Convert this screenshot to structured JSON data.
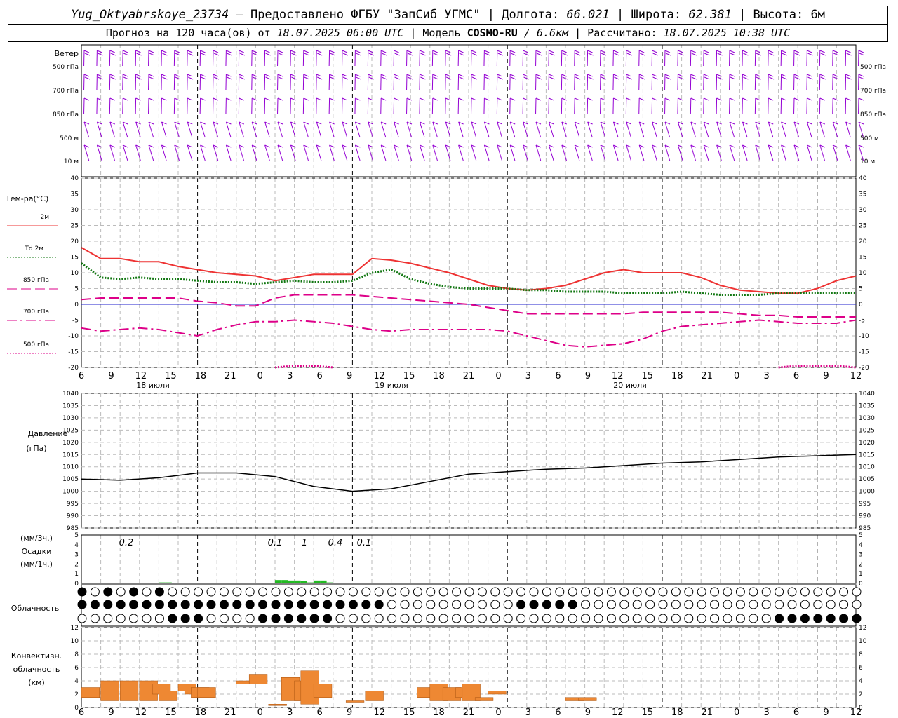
{
  "header": {
    "station": "Yug_Oktyabrskoye_23734",
    "provided_by": "— Предоставлено ФГБУ \"ЗапСиб УГМС\"",
    "lon_label": "| Долгота:",
    "lon_value": "66.021",
    "lat_label": "| Широта:",
    "lat_value": "62.381",
    "alt_label": "| Высота:",
    "alt_value": "6м",
    "forecast_label": "Прогноз на 120 часа(ов) от",
    "forecast_start": "18.07.2025 06:00 UTC",
    "model_label": "| Модель",
    "model_name": "COSMO-RU",
    "model_res": "/ 6.6км",
    "computed_label": "| Рассчитано:",
    "computed_value": "18.07.2025 10:38 UTC"
  },
  "colors": {
    "wind": "#9400d3",
    "t2m": "#ee3333",
    "td2m": "#117711",
    "t850": "#dd0088",
    "t700": "#dd0088",
    "t500": "#dd0088",
    "zero_line": "#2222cc",
    "precip": "#22bb22",
    "conv": "#ee8833",
    "grid": "#bbbbbb"
  },
  "wind_panel": {
    "title": "Ветер",
    "levels": [
      "500 гПа",
      "700 гПа",
      "850 гПа",
      "500 м",
      "10 м"
    ],
    "right_levels": [
      "500 гПа",
      "700 гПа",
      "850 гПа",
      "500 м",
      "10 м"
    ]
  },
  "temp_panel": {
    "title": "Тем-ра(°C)",
    "legend": [
      {
        "label": "2м",
        "style": "solid"
      },
      {
        "label": "Td 2м",
        "style": "dotted"
      },
      {
        "label": "850 гПа",
        "style": "dashed"
      },
      {
        "label": "700 гПа",
        "style": "dashdot"
      },
      {
        "label": "500 гПа",
        "style": "dash-dot-dot"
      }
    ],
    "yticks": [
      "40",
      "35",
      "30",
      "25",
      "20",
      "15",
      "10",
      "5",
      "0",
      "-5",
      "-10",
      "-15",
      "-20"
    ]
  },
  "time_axis": {
    "hour_labels": [
      "6",
      "9",
      "12",
      "15",
      "18",
      "21",
      "0",
      "3",
      "6",
      "9",
      "12",
      "15",
      "18",
      "21",
      "0",
      "3",
      "6",
      "9",
      "12",
      "15",
      "18",
      "21",
      "0",
      "3",
      "6",
      "9",
      "12"
    ],
    "day_labels": [
      "18 июля",
      "19 июля",
      "20 июля"
    ]
  },
  "pressure_panel": {
    "title": "Давление",
    "unit": "(гПа)",
    "yticks": [
      "1040",
      "1035",
      "1030",
      "1025",
      "1020",
      "1015",
      "1010",
      "1005",
      "1000",
      "995",
      "990",
      "985"
    ]
  },
  "precip_panel": {
    "title1": "(мм/3ч.)",
    "title2": "Осадки",
    "title3": "(мм/1ч.)",
    "yticks": [
      "5",
      "4",
      "3",
      "2",
      "1",
      "0"
    ],
    "totals": [
      {
        "label": "0.2"
      },
      {
        "label": "0.1"
      },
      {
        "label": "1"
      },
      {
        "label": "0.4"
      },
      {
        "label": "0.1"
      }
    ]
  },
  "cloud_panel": {
    "title": "Облачность"
  },
  "conv_panel": {
    "title1": "Конвективн.",
    "title2": "облачность",
    "title3": "(км)",
    "yticks": [
      "12",
      "10",
      "8",
      "6",
      "4",
      "2",
      "0"
    ]
  },
  "chart_data": {
    "type": "line",
    "x_unit": "hours since 18.07.2025 06:00 UTC",
    "temperature": {
      "ylim": [
        -20,
        40
      ],
      "x": [
        0,
        3,
        6,
        9,
        12,
        15,
        18,
        21,
        24,
        27,
        30,
        33,
        36,
        39,
        42,
        45,
        48,
        51,
        54,
        57,
        60,
        63,
        66,
        69,
        72,
        75,
        78,
        81,
        84,
        87,
        90,
        93,
        96,
        99,
        102,
        105,
        108,
        111,
        114,
        117,
        120
      ],
      "series": [
        {
          "name": "2м",
          "values": [
            18,
            14.5,
            14.5,
            13.5,
            13.5,
            12,
            11,
            10,
            9.5,
            9,
            7.5,
            8.5,
            9.5,
            9.5,
            9.5,
            14.5,
            14,
            13,
            11.5,
            10,
            8,
            6,
            5,
            4.5,
            5,
            6,
            8,
            10,
            11,
            10,
            10,
            10,
            8.5,
            6,
            4.5,
            4,
            3.5,
            3.5,
            5,
            7.5,
            9
          ]
        },
        {
          "name": "Td 2м",
          "values": [
            13,
            8.5,
            8,
            8.5,
            8,
            8,
            7.5,
            7,
            7,
            6.5,
            7,
            7.5,
            7,
            7,
            7.5,
            10,
            11,
            8,
            6.5,
            5.5,
            5,
            5,
            5,
            4.5,
            4.5,
            4,
            4,
            4,
            3.5,
            3.5,
            3.5,
            4,
            3.5,
            3,
            3,
            3,
            3.5,
            3.5,
            3.5,
            3.5,
            3.5
          ]
        },
        {
          "name": "850 гПа",
          "values": [
            1.5,
            2,
            2,
            2,
            2,
            2,
            1,
            0.5,
            -0.5,
            -0.5,
            2,
            3,
            3,
            3,
            3,
            2.5,
            2,
            1.5,
            1,
            0.5,
            0,
            -1,
            -2,
            -3,
            -3,
            -3,
            -3,
            -3,
            -3,
            -2.5,
            -2.5,
            -2.5,
            -2.5,
            -2.5,
            -3,
            -3.5,
            -3.5,
            -4,
            -4,
            -4,
            -4
          ]
        },
        {
          "name": "700 гПа",
          "values": [
            -7.5,
            -8.5,
            -8,
            -7.5,
            -8,
            -9,
            -10,
            -8,
            -6.5,
            -5.5,
            -5.5,
            -5,
            -5.5,
            -6,
            -7,
            -8,
            -8.5,
            -8,
            -8,
            -8,
            -8,
            -8,
            -8.5,
            -10,
            -11.5,
            -13,
            -13.5,
            -13,
            -12.5,
            -11,
            -8.5,
            -7,
            -6.5,
            -6,
            -5.5,
            -5,
            -5.5,
            -6,
            -6,
            -6,
            -5
          ]
        },
        {
          "name": "500 гПа",
          "values": [
            null,
            null,
            null,
            null,
            null,
            null,
            null,
            null,
            null,
            null,
            -20,
            -19.5,
            -19.5,
            -20,
            null,
            null,
            null,
            null,
            null,
            null,
            null,
            null,
            null,
            null,
            null,
            null,
            null,
            null,
            null,
            null,
            null,
            null,
            null,
            null,
            null,
            null,
            -20,
            -19.5,
            -19.5,
            -19.5,
            -20
          ]
        }
      ]
    },
    "pressure": {
      "ylim": [
        985,
        1040
      ],
      "x": [
        0,
        6,
        12,
        18,
        24,
        30,
        36,
        42,
        48,
        54,
        60,
        66,
        72,
        78,
        84,
        90,
        96,
        102,
        108,
        114,
        120
      ],
      "values": [
        1005,
        1004.5,
        1005.5,
        1007.5,
        1007.5,
        1006,
        1002,
        1000,
        1001,
        1004,
        1007,
        1008,
        1009,
        1009.5,
        1010.5,
        1011.5,
        1012,
        1013,
        1014,
        1014.5,
        1015
      ]
    },
    "precip": {
      "ylim": [
        0,
        5
      ],
      "x": [
        12,
        13,
        14,
        15,
        16,
        30,
        31,
        32,
        33,
        34,
        35,
        36,
        37,
        38
      ],
      "values": [
        0.1,
        0.1,
        0.05,
        0.05,
        0.05,
        0.35,
        0.35,
        0.3,
        0.3,
        0.25,
        0.1,
        0.3,
        0.3,
        0.1
      ]
    },
    "convective_cloud": {
      "ylim": [
        0,
        12
      ],
      "bars": [
        {
          "x": 0,
          "base": 1.5,
          "top": 3.0
        },
        {
          "x": 3,
          "base": 1.0,
          "top": 4.0
        },
        {
          "x": 6,
          "base": 1.0,
          "top": 4.0
        },
        {
          "x": 9,
          "base": 1.0,
          "top": 4.0
        },
        {
          "x": 11,
          "base": 2.0,
          "top": 3.5
        },
        {
          "x": 12,
          "base": 1.0,
          "top": 2.5
        },
        {
          "x": 15,
          "base": 2.5,
          "top": 3.5
        },
        {
          "x": 16,
          "base": 2.0,
          "top": 2.5
        },
        {
          "x": 17,
          "base": 1.5,
          "top": 3.0
        },
        {
          "x": 18,
          "base": 1.5,
          "top": 3.0
        },
        {
          "x": 24,
          "base": 3.5,
          "top": 4.0
        },
        {
          "x": 26,
          "base": 3.5,
          "top": 5.0
        },
        {
          "x": 29,
          "base": 0.5,
          "top": 0.5
        },
        {
          "x": 31,
          "base": 1.0,
          "top": 4.5
        },
        {
          "x": 33,
          "base": 1.0,
          "top": 4.0
        },
        {
          "x": 34,
          "base": 0.5,
          "top": 5.5
        },
        {
          "x": 36,
          "base": 1.5,
          "top": 3.5
        },
        {
          "x": 41,
          "base": 1.0,
          "top": 1.0
        },
        {
          "x": 44,
          "base": 1.0,
          "top": 2.5
        },
        {
          "x": 52,
          "base": 1.5,
          "top": 3.0
        },
        {
          "x": 54,
          "base": 1.0,
          "top": 3.5
        },
        {
          "x": 56,
          "base": 1.0,
          "top": 3.0
        },
        {
          "x": 58,
          "base": 1.5,
          "top": 3.0
        },
        {
          "x": 59,
          "base": 1.0,
          "top": 3.5
        },
        {
          "x": 61,
          "base": 1.0,
          "top": 1.5
        },
        {
          "x": 63,
          "base": 2.0,
          "top": 2.5
        },
        {
          "x": 75,
          "base": 1.0,
          "top": 1.5
        },
        {
          "x": 77,
          "base": 1.0,
          "top": 1.5
        }
      ]
    },
    "cloud_cover_rows": [
      "high",
      "middle",
      "low"
    ]
  }
}
